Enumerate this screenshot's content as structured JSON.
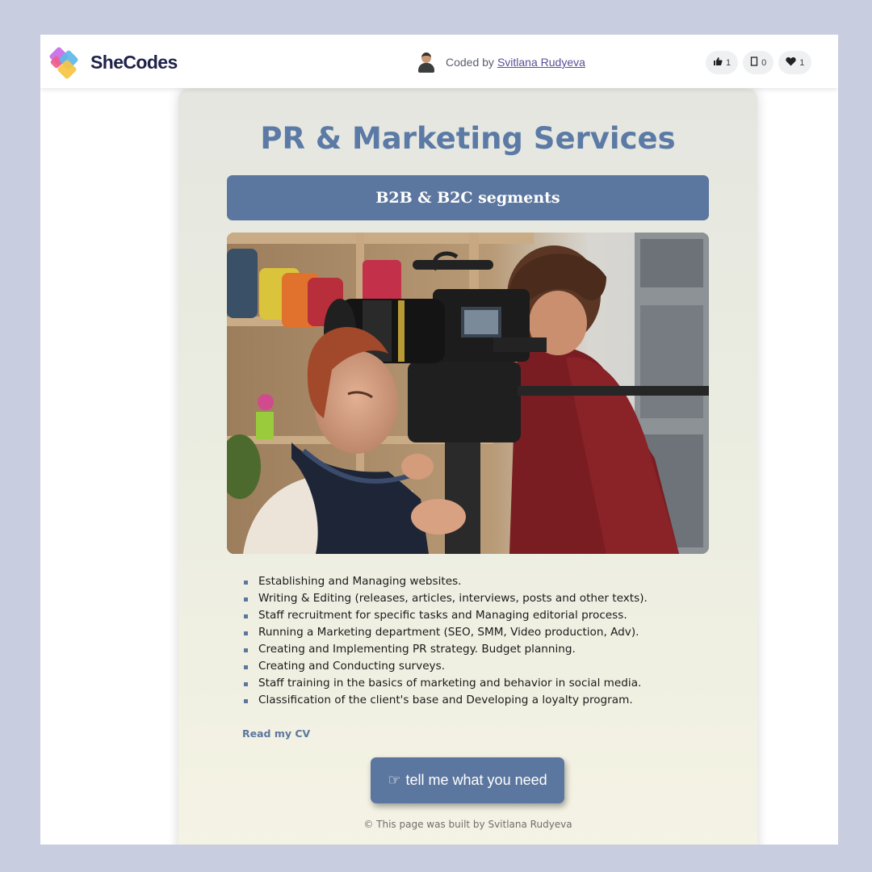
{
  "header": {
    "logo_text": "SheCodes",
    "coded_by_label": "Coded by",
    "author_name": "Svitlana Rudyeva",
    "stats": [
      {
        "icon": "thumbs-up-icon",
        "count": "1"
      },
      {
        "icon": "copy-icon",
        "count": "0"
      },
      {
        "icon": "heart-icon",
        "count": "1"
      }
    ]
  },
  "page": {
    "title": "PR & Marketing Services",
    "banner": "B2B & B2C segments",
    "services": [
      "Establishing and Managing websites.",
      "Writing & Editing (releases, articles, interviews, posts and other texts).",
      "Staff recruitment for specific tasks and Managing editorial process.",
      "Running a Marketing department (SEO, SMM, Video production, Adv).",
      "Creating and Implementing PR strategy. Budget planning.",
      "Creating and Conducting surveys.",
      "Staff training in the basics of marketing and behavior in social media.",
      "Classification of the client's base and Developing a loyalty program."
    ],
    "cv_link": "Read my CV",
    "cta_icon": "☞",
    "cta_label": "tell me what you need",
    "footer": "© This page was built by Svitlana Rudyeva"
  },
  "colors": {
    "accent": "#5c779f",
    "title": "#5b7aa5",
    "page_bg": "#c9cde0"
  }
}
